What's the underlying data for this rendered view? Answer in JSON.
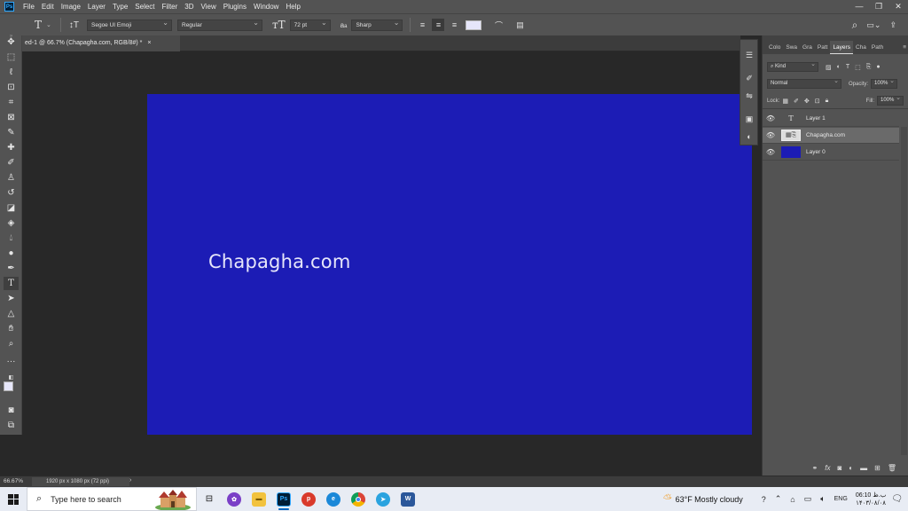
{
  "menu": [
    "File",
    "Edit",
    "Image",
    "Layer",
    "Type",
    "Select",
    "Filter",
    "3D",
    "View",
    "Plugins",
    "Window",
    "Help"
  ],
  "options_bar": {
    "font_family": "Segoe UI Emoji",
    "font_style": "Regular",
    "font_size": "72 pt",
    "aa_label": "a",
    "antialias": "Sharp",
    "text_color": "#e6e6fa"
  },
  "document": {
    "tab_title": "ed-1 @ 66.7% (Chapagha.com, RGB/8#) *",
    "close": "×",
    "canvas_text": "Chapagha.com",
    "canvas_color": "#1c1cb5"
  },
  "status": {
    "zoom": "66.67%",
    "doc_info": "1920 px x 1080 px (72 ppi)",
    "arrow": "›"
  },
  "panel": {
    "tabs": [
      "Colo",
      "Swa",
      "Gra",
      "Patt",
      "Layers",
      "Cha",
      "Path"
    ],
    "kind": "Kind",
    "blend_mode": "Normal",
    "opacity_label": "Opacity:",
    "opacity": "100%",
    "lock_label": "Lock:",
    "fill_label": "Fill:",
    "fill": "100%",
    "layers": [
      {
        "name": "Layer 1",
        "type": "text"
      },
      {
        "name": "Chapagha.com",
        "type": "smart"
      },
      {
        "name": "Layer 0",
        "type": "fill",
        "color": "#1c1cb5"
      }
    ]
  },
  "taskbar": {
    "search_placeholder": "Type here to search",
    "weather": "63°F  Mostly cloudy",
    "language": "ENG",
    "time": "06:10 ب.ظ",
    "date": "۱۴۰۳/۰۸/۰۸",
    "ps_label": "Ps",
    "word_label": "W"
  }
}
